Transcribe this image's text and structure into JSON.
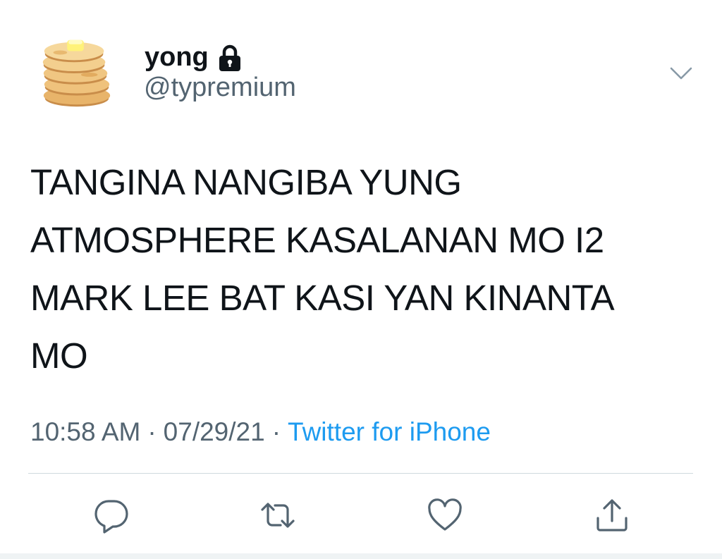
{
  "user": {
    "name": "yong",
    "handle": "@typremium",
    "avatar_icon": "pancake-stack-avatar",
    "protected_icon": "lock-icon"
  },
  "menu": {
    "icon": "chevron-down-icon"
  },
  "tweet": {
    "text": "TANGINA NANGIBA YUNG\nATMOSPHERE KASALANAN MO I2\nMARK LEE BAT KASI YAN KINANTA\nMO",
    "time": "10:58 AM",
    "date": "07/29/21",
    "source": "Twitter for iPhone",
    "separator": "·"
  },
  "actions": {
    "reply_icon": "reply-icon",
    "retweet_icon": "retweet-icon",
    "like_icon": "heart-icon",
    "share_icon": "share-icon"
  },
  "colors": {
    "text": "#0f1419",
    "secondary": "#536471",
    "link": "#1d9bf0",
    "divider": "#cfd9de"
  }
}
